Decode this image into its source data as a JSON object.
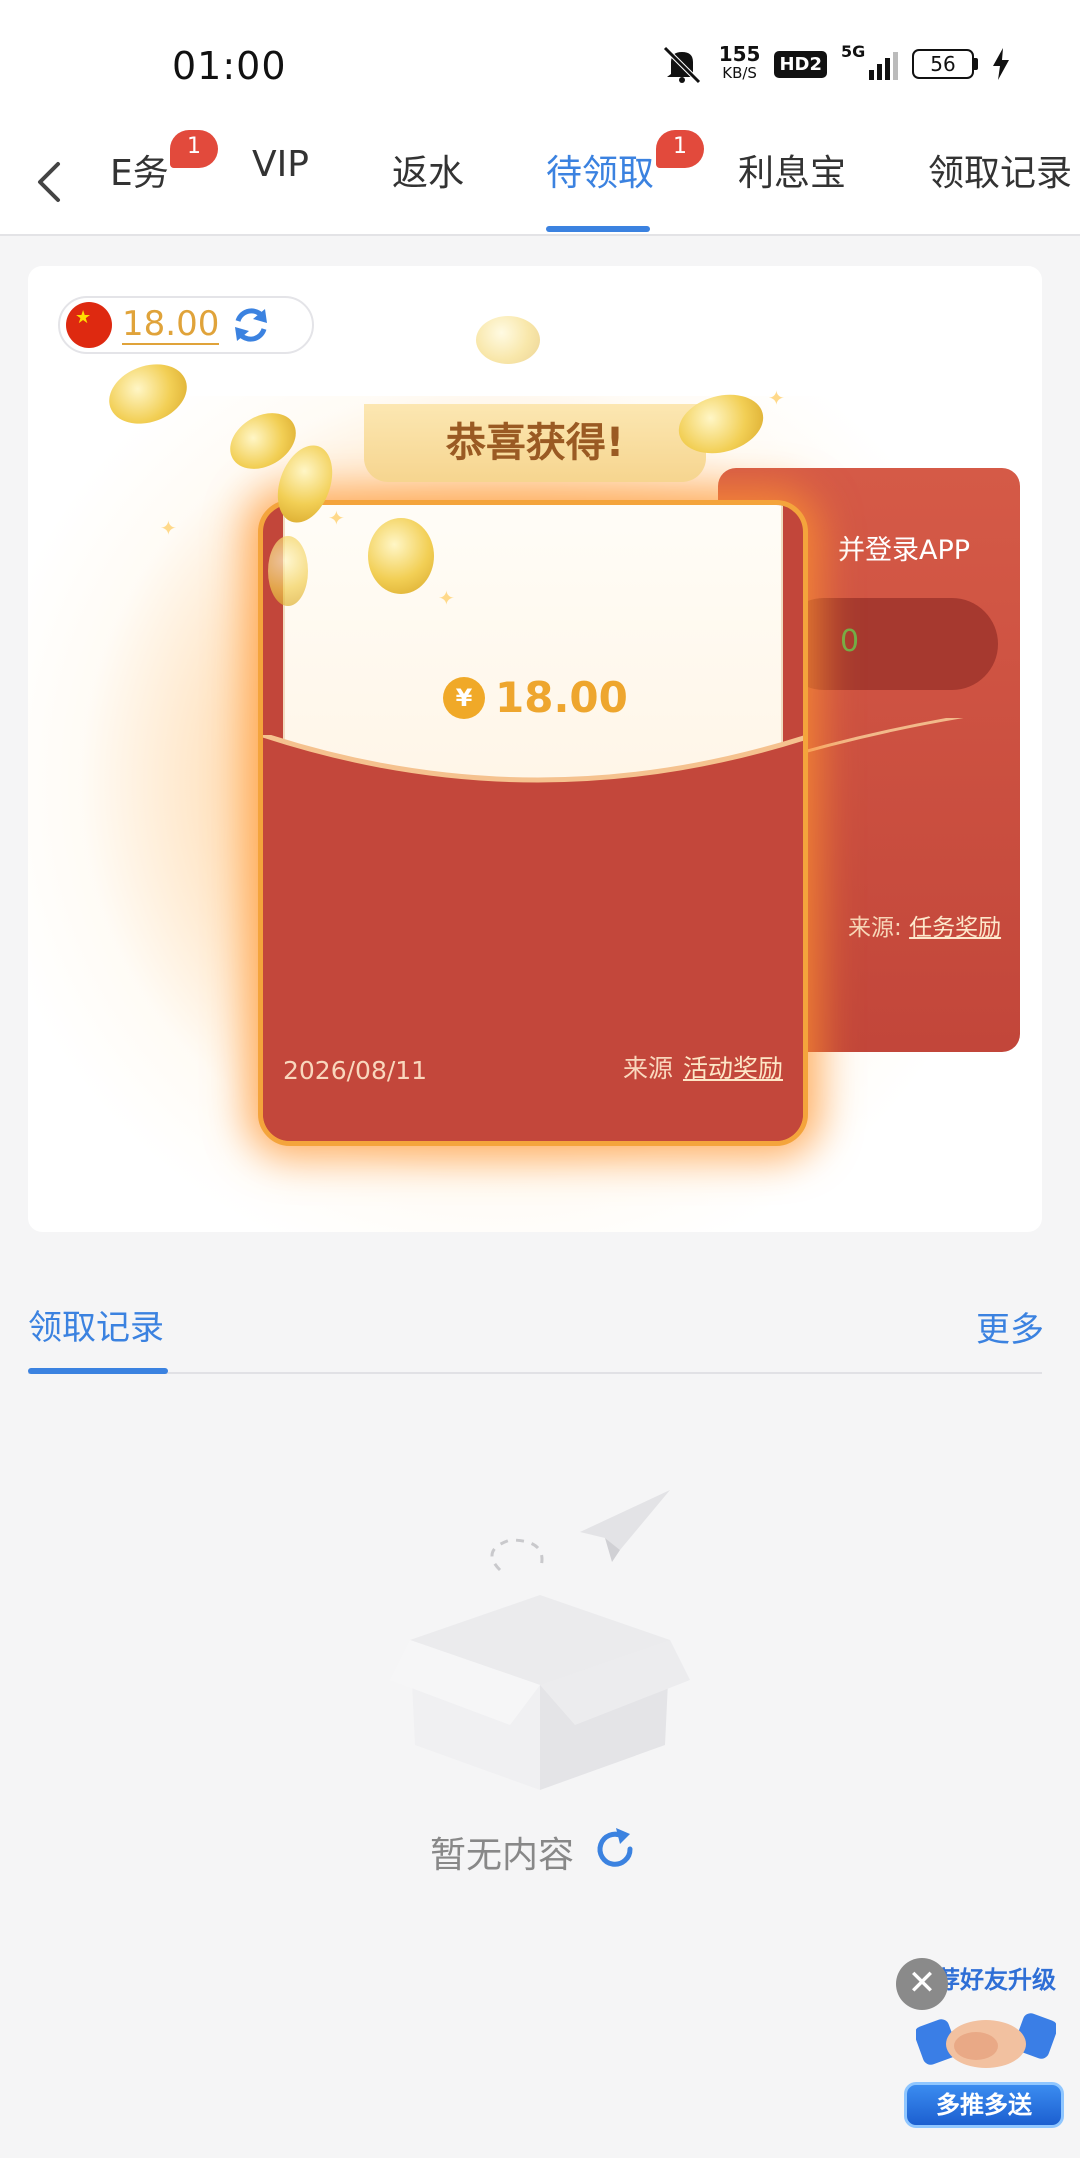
{
  "status_bar": {
    "time": "01:00",
    "net_speed_value": "155",
    "net_speed_unit": "KB/S",
    "hd_label": "HD2",
    "network_label": "5G",
    "battery": "56",
    "icons": [
      "mute-icon",
      "signal-icon",
      "battery-icon",
      "charging-icon"
    ]
  },
  "tabs": {
    "items": [
      {
        "label": "任务",
        "badge": "1"
      },
      {
        "label": "VIP"
      },
      {
        "label": "返水"
      },
      {
        "label": "待领取",
        "badge": "1",
        "active": true
      },
      {
        "label": "利息宝"
      },
      {
        "label": "领取记录"
      }
    ],
    "visible_partial_first": "E务",
    "accent": "#3b82e0"
  },
  "balance": {
    "amount": "18.00",
    "currency_icon": "china-flag-icon",
    "refresh_icon": "refresh-icon"
  },
  "red_packet": {
    "congrats": "恭喜获得!",
    "amount": "18.00",
    "date": "2026/08/11",
    "source_label": "来源",
    "source_value": "活动奖励"
  },
  "red_packet_back": {
    "title_partial": "并登录APP",
    "pill_text": "0",
    "source_label": "来源:",
    "source_value": "任务奖励"
  },
  "records": {
    "title": "领取记录",
    "more": "更多",
    "empty_text": "暂无内容"
  },
  "promo": {
    "title": "推荐好友升级",
    "title_partial": "荐好友升级",
    "button": "多推多送",
    "close": "✕"
  }
}
